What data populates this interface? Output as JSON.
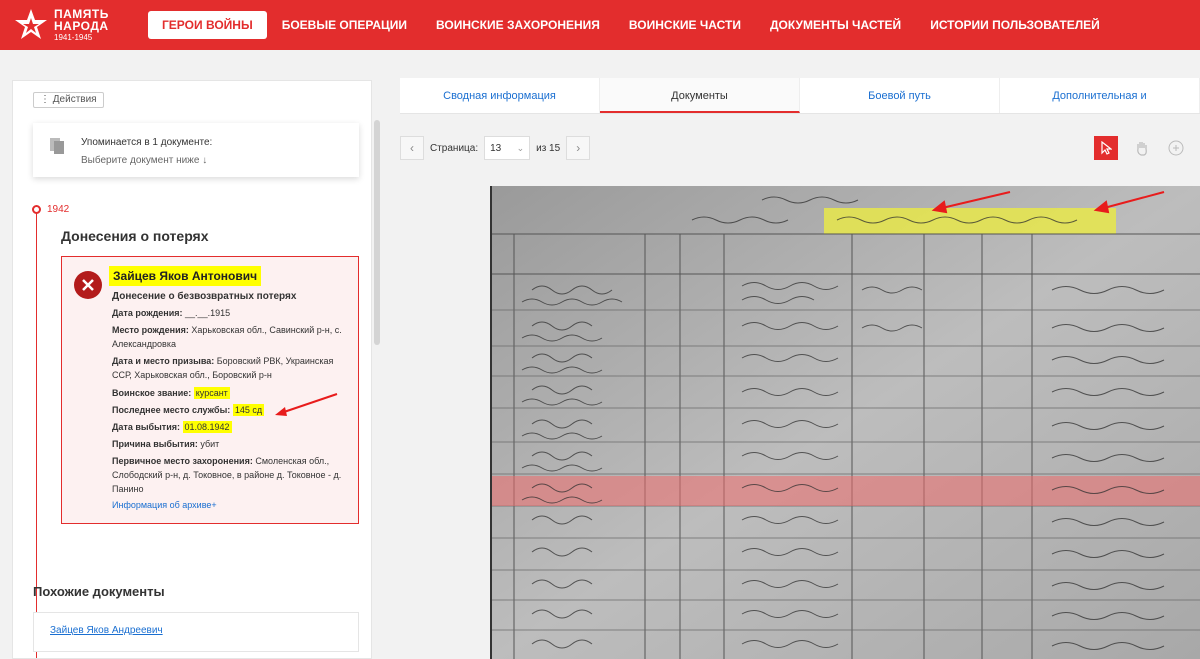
{
  "header": {
    "logo": {
      "line1": "ПАМЯТЬ",
      "line2": "НАРОДА",
      "line3": "1941-1945"
    },
    "nav": [
      "ГЕРОИ ВОЙНЫ",
      "БОЕВЫЕ ОПЕРАЦИИ",
      "ВОИНСКИЕ ЗАХОРОНЕНИЯ",
      "ВОИНСКИЕ ЧАСТИ",
      "ДОКУМЕНТЫ ЧАСТЕЙ",
      "ИСТОРИИ ПОЛЬЗОВАТЕЛЕЙ"
    ],
    "active_nav": 0
  },
  "left": {
    "actions_label": "⋮ Действия",
    "mention": {
      "title": "Упоминается в 1 документе:",
      "subtitle": "Выберите документ ниже ↓"
    },
    "year": "1942",
    "section_title": "Донесения о потерях",
    "card": {
      "name": "Зайцев Яков Антонович",
      "doc_type": "Донесение о безвозвратных потерях",
      "fields": [
        {
          "label": "Дата рождения:",
          "value": "__.__.1915"
        },
        {
          "label": "Место рождения:",
          "value": "Харьковская обл., Савинский р-н, с. Александровка"
        },
        {
          "label": "Дата и место призыва:",
          "value": "Боровский РВК, Украинская ССР, Харьковская обл., Боровский р-н"
        },
        {
          "label": "Воинское звание:",
          "value": "курсант"
        },
        {
          "label": "Последнее место службы:",
          "value": "145 сд"
        },
        {
          "label": "Дата выбытия:",
          "value": "01.08.1942"
        },
        {
          "label": "Причина выбытия:",
          "value": "убит"
        },
        {
          "label": "Первичное место захоронения:",
          "value": "Смоленская обл., Слободский р-н, д. Токовное, в районе д. Токовное - д. Панино"
        }
      ],
      "archive_link": "Информация об архиве+"
    },
    "similar_title": "Похожие документы",
    "similar_items": [
      "Зайцев Яков Андреевич"
    ]
  },
  "tabs": [
    "Сводная информация",
    "Документы",
    "Боевой путь",
    "Дополнительная и"
  ],
  "active_tab": 1,
  "pager": {
    "label": "Страница:",
    "page": "13",
    "of": "из 15"
  },
  "colors": {
    "accent": "#e32d2d",
    "link": "#1a6fd1",
    "highlight": "#ffff00"
  },
  "icons": [
    "document-icon",
    "close-icon",
    "chevron-left-icon",
    "chevron-right-icon",
    "chevron-down-icon",
    "cursor-icon",
    "hand-icon",
    "zoom-in-icon"
  ]
}
